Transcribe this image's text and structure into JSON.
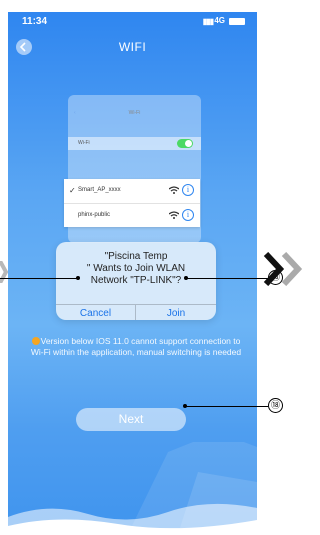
{
  "status_bar": {
    "time": "11:34",
    "network": "4G"
  },
  "header": {
    "title": "WIFI"
  },
  "illustration": {
    "nav_title": "Wi-Fi",
    "wifi_label": "Wi-Fi",
    "networks": [
      {
        "name": "Smart_AP_xxxx",
        "selected": true
      },
      {
        "name": "phinx-public",
        "selected": false
      }
    ]
  },
  "dialog": {
    "message_lines": [
      "\"Piscina Temp",
      "\" Wants to Join WLAN",
      "Network \"TP-LINK\"?"
    ],
    "cancel_label": "Cancel",
    "join_label": "Join"
  },
  "notice": {
    "text": "Version below IOS 11.0 cannot support connection to Wi-Fi within the application, manual switching is needed"
  },
  "next_button": {
    "label": "Next"
  },
  "annotations": {
    "join": "⑯",
    "next": "⑱"
  },
  "colors": {
    "primary": "#2f86f0",
    "link": "#1a73e8",
    "toggle_on": "#4cd964",
    "notice_dot": "#f5a623"
  }
}
